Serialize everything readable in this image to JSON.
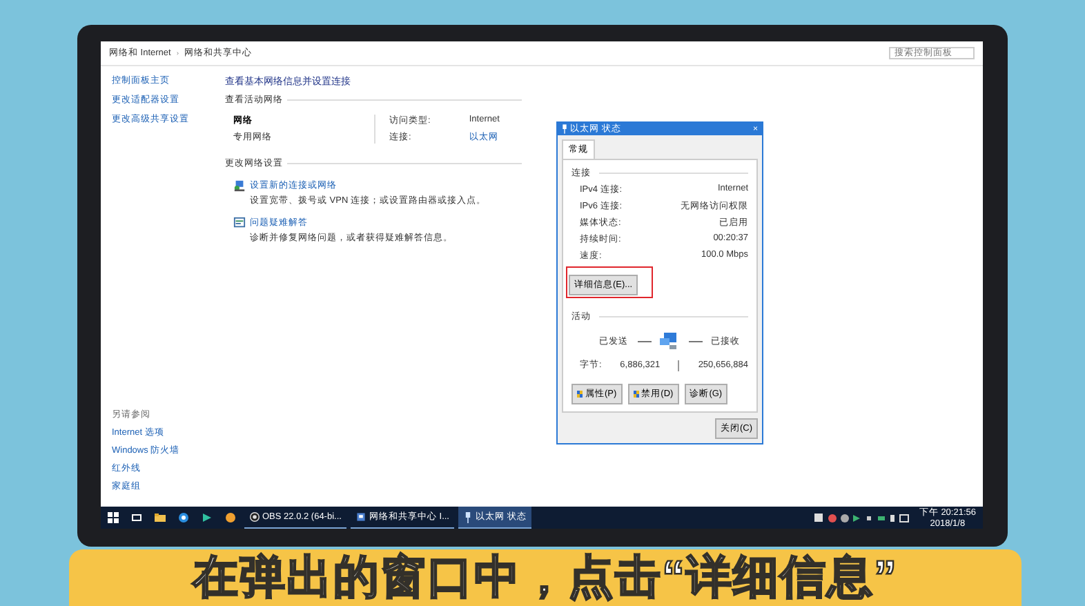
{
  "window": {
    "breadcrumb": [
      "网络和 Internet",
      "网络和共享中心"
    ],
    "breadcrumb_separator": "›",
    "search": {
      "placeholder": "搜索控制面板"
    }
  },
  "sidebar": {
    "items": [
      "控制面板主页",
      "更改适配器设置",
      "更改高级共享设置"
    ],
    "see_also": {
      "title": "另请参阅",
      "items": [
        "Internet 选项",
        "Windows 防火墙",
        "红外线",
        "家庭组"
      ]
    }
  },
  "main": {
    "title": "查看基本网络信息并设置连接",
    "active_section": "查看活动网络",
    "network": {
      "name": "网络",
      "type": "专用网络",
      "access_label": "访问类型:",
      "access_value": "Internet",
      "connection_label": "连接:",
      "connection_value": "以太网"
    },
    "change_section": "更改网络设置",
    "tasks": [
      {
        "kind": "new",
        "title": "设置新的连接或网络",
        "desc": "设置宽带、拨号或 VPN 连接；或设置路由器或接入点。"
      },
      {
        "kind": "trouble",
        "title": "问题疑难解答",
        "desc": "诊断并修复网络问题，或者获得疑难解答信息。"
      }
    ]
  },
  "dialog": {
    "title": "以太网 状态",
    "close_glyph": "×",
    "tabs": [
      {
        "label": "常规",
        "selected": true
      }
    ],
    "connection_section": "连接",
    "rows": [
      {
        "label": "IPv4 连接:",
        "value": "Internet"
      },
      {
        "label": "IPv6 连接:",
        "value": "无网络访问权限"
      },
      {
        "label": "媒体状态:",
        "value": "已启用"
      },
      {
        "label": "持续时间:",
        "value": "00:20:37"
      },
      {
        "label": "速度:",
        "value": "100.0 Mbps"
      }
    ],
    "details_button": {
      "label": "详细信息(E)...",
      "highlighted": true
    },
    "activity_section": "活动",
    "sent_label": "已发送",
    "received_label": "已接收",
    "bytes_label": "字节:",
    "sent": "6,886,321",
    "received": "250,656,884",
    "buttons": [
      {
        "label": "属性(P)",
        "shield": true
      },
      {
        "label": "禁用(D)",
        "shield": true
      },
      {
        "label": "诊断(G)",
        "shield": false
      }
    ],
    "close": "关闭(C)"
  },
  "taskbar": {
    "tasks": [
      {
        "label": "OBS 22.0.2 (64-bi...",
        "kind": "obs",
        "selected": false
      },
      {
        "label": "网络和共享中心 I...",
        "kind": "network",
        "selected": false
      },
      {
        "label": "以太网 状态",
        "kind": "ethernet",
        "selected": true
      }
    ],
    "time": "下午 20:21:56",
    "date": "2018/1/8"
  },
  "caption": "在弹出的窗口中，点击“详细信息”"
}
